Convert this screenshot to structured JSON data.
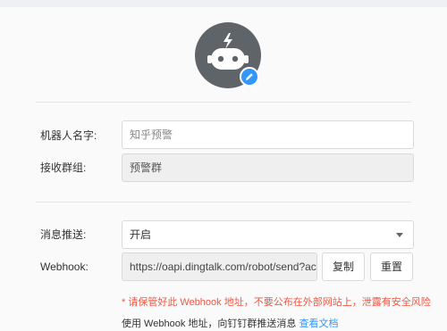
{
  "avatar": {
    "icon": "robot-icon",
    "edit_icon": "pencil-icon",
    "edit_color": "#3296fa"
  },
  "form": {
    "name_label": "机器人名字:",
    "name_value": "",
    "name_placeholder": "知乎预警",
    "group_label": "接收群组:",
    "group_value": "预警群",
    "push_label": "消息推送:",
    "push_value": "开启",
    "webhook_label": "Webhook:",
    "webhook_value": "https://oapi.dingtalk.com/robot/send?access_token=",
    "copy_button": "复制",
    "reset_button": "重置"
  },
  "notes": {
    "warning": "* 请保管好此 Webhook 地址，不要公布在外部网站上，泄露有安全风险",
    "hint_prefix": "使用 Webhook 地址，向钉钉群推送消息",
    "hint_link": "查看文档"
  },
  "colors": {
    "accent": "#3296fa",
    "warning": "#f25643",
    "avatar_bg": "#5f6469"
  }
}
